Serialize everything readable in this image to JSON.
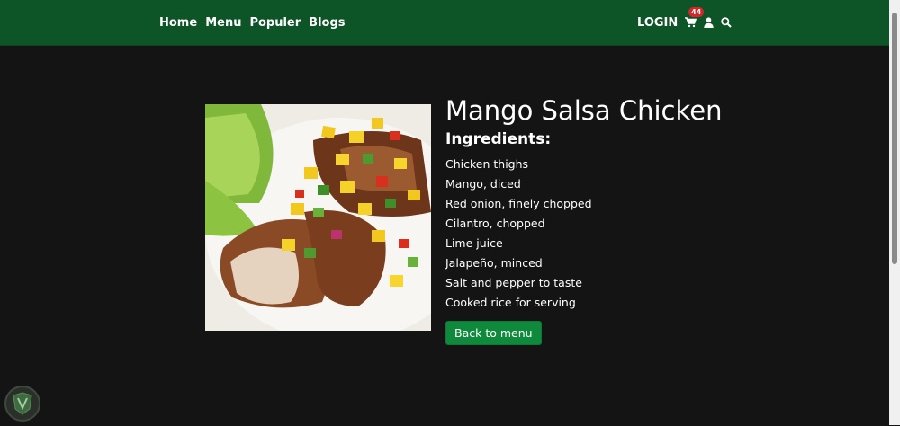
{
  "nav": {
    "links": [
      {
        "label": "Home"
      },
      {
        "label": "Menu"
      },
      {
        "label": "Populer"
      },
      {
        "label": "Blogs"
      }
    ],
    "login_label": "LOGIN",
    "cart_count": "44"
  },
  "recipe": {
    "title": "Mango Salsa Chicken",
    "ingredients_heading": "Ingredients:",
    "ingredients": [
      "Chicken thighs",
      "Mango, diced",
      "Red onion, finely chopped",
      "Cilantro, chopped",
      "Lime juice",
      "Jalapeño, minced",
      "Salt and pepper to taste",
      "Cooked rice for serving"
    ],
    "back_label": "Back to menu"
  },
  "colors": {
    "navbar": "#0d5427",
    "background": "#141414",
    "button": "#0f8a3c",
    "badge": "#d9252a"
  },
  "icons": [
    "cart-icon",
    "user-icon",
    "search-icon"
  ]
}
